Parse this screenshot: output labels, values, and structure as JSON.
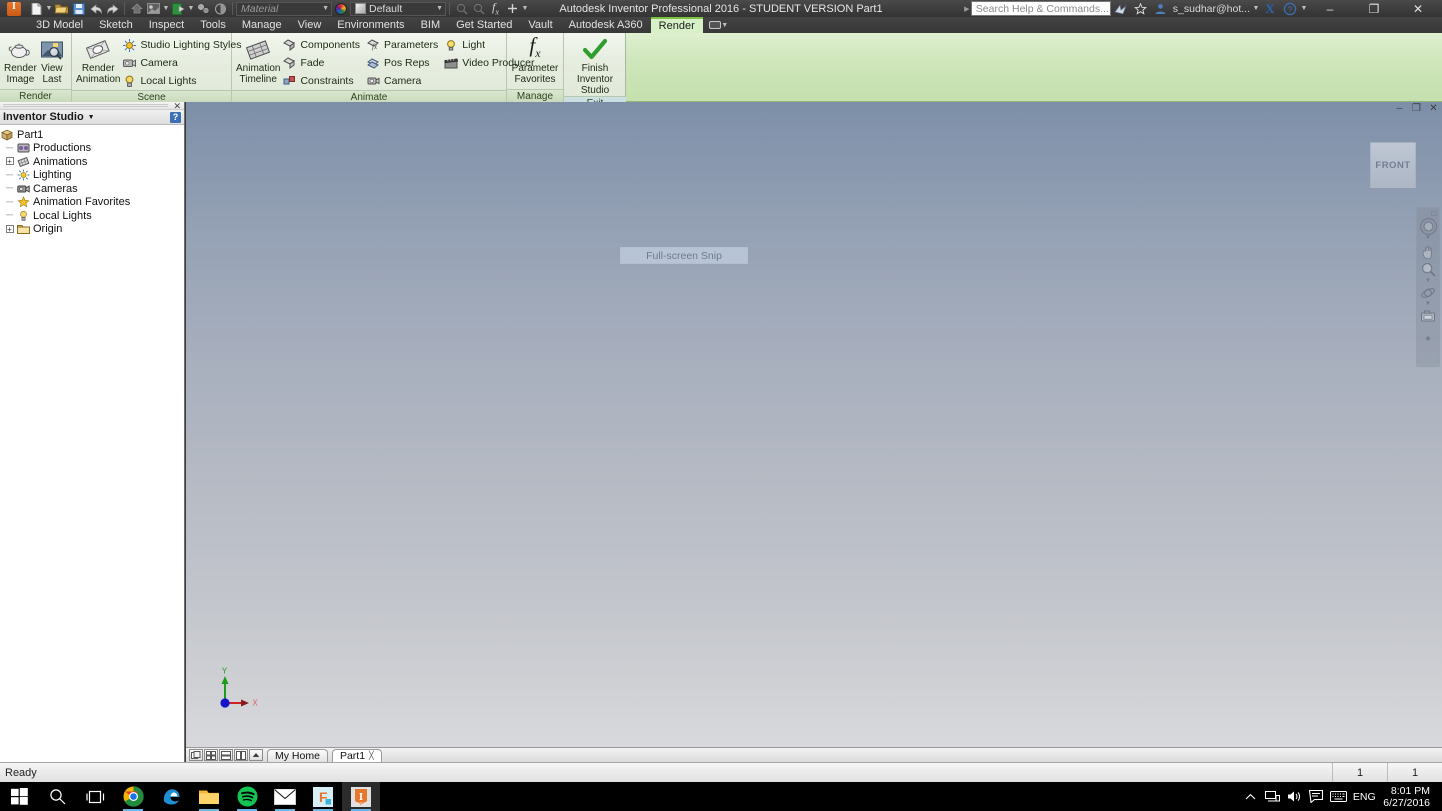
{
  "titlebar": {
    "app_logo": "inventor-logo",
    "title": "Autodesk Inventor Professional 2016 - STUDENT VERSION    Part1",
    "quick_access": [
      {
        "name": "new-file",
        "icon": "new-document-icon",
        "caret": true
      },
      {
        "name": "open-file",
        "icon": "open-folder-icon",
        "caret": false
      },
      {
        "name": "save-file",
        "icon": "save-disk-icon",
        "caret": false
      },
      {
        "name": "undo",
        "icon": "undo-arrow-icon",
        "caret": false
      },
      {
        "name": "redo",
        "icon": "redo-arrow-icon",
        "caret": false
      },
      {
        "name": "home-view",
        "icon": "home-icon",
        "caret": false
      },
      {
        "name": "appearance",
        "icon": "appearance-icon",
        "caret": true
      },
      {
        "name": "visual-style",
        "icon": "visual-style-icon",
        "caret": true
      },
      {
        "name": "component-visibility",
        "icon": "component-icon",
        "caret": false
      },
      {
        "name": "shadows",
        "icon": "shadow-sphere-icon",
        "caret": false
      }
    ],
    "material_combo": {
      "value": "",
      "placeholder": "Material"
    },
    "appearance_combo": {
      "value": "Default"
    },
    "right_icons": [
      {
        "name": "share-icon"
      },
      {
        "name": "favorites-star-icon"
      },
      {
        "name": "user-account-icon"
      }
    ],
    "account": "s_sudhar@hot...",
    "exchange_icon": "autodesk-exchange-icon",
    "help_icon": "help-question-icon",
    "search": {
      "placeholder": "Search Help & Commands..."
    },
    "window_controls": {
      "minimize": "–",
      "maximize": "❐",
      "close": "✕"
    }
  },
  "ribbon_tabs": {
    "items": [
      {
        "label": "3D Model",
        "active": false
      },
      {
        "label": "Sketch",
        "active": false
      },
      {
        "label": "Inspect",
        "active": false
      },
      {
        "label": "Tools",
        "active": false
      },
      {
        "label": "Manage",
        "active": false
      },
      {
        "label": "View",
        "active": false
      },
      {
        "label": "Environments",
        "active": false
      },
      {
        "label": "BIM",
        "active": false
      },
      {
        "label": "Get Started",
        "active": false
      },
      {
        "label": "Vault",
        "active": false
      },
      {
        "label": "Autodesk A360",
        "active": false
      },
      {
        "label": "Render",
        "active": true
      }
    ]
  },
  "ribbon": {
    "panels": [
      {
        "title": "Render",
        "big_buttons": [
          {
            "name": "render-image-button",
            "line1": "Render",
            "line2": "Image",
            "icon": "teapot-icon"
          },
          {
            "name": "view-last-button",
            "line1": "View",
            "line2": "Last",
            "icon": "picture-zoom-icon"
          }
        ]
      },
      {
        "title": "Scene",
        "big_buttons": [
          {
            "name": "render-animation-button",
            "line1": "Render",
            "line2": "Animation",
            "icon": "teapot-film-icon"
          }
        ],
        "small_buttons": [
          {
            "name": "studio-lighting-styles-button",
            "label": "Studio Lighting Styles",
            "icon": "lighting-styles-icon"
          },
          {
            "name": "camera-button",
            "label": "Camera",
            "icon": "camera-icon"
          },
          {
            "name": "local-lights-button",
            "label": "Local Lights",
            "icon": "bulb-icon"
          }
        ]
      },
      {
        "title": "Animate",
        "big_buttons": [
          {
            "name": "animation-timeline-button",
            "line1": "Animation",
            "line2": "Timeline",
            "icon": "timeline-icon"
          }
        ],
        "small_buttons": [
          {
            "name": "animate-components-button",
            "label": "Components",
            "icon": "components-icon"
          },
          {
            "name": "animate-fade-button",
            "label": "Fade",
            "icon": "fade-icon"
          },
          {
            "name": "animate-constraints-button",
            "label": "Constraints",
            "icon": "constraints-icon"
          },
          {
            "name": "animate-parameters-button",
            "label": "Parameters",
            "icon": "parameters-icon"
          },
          {
            "name": "animate-posreps-button",
            "label": "Pos Reps",
            "icon": "posreps-icon"
          },
          {
            "name": "animate-camera-button",
            "label": "Camera",
            "icon": "camera-anim-icon"
          },
          {
            "name": "animate-light-button",
            "label": "Light",
            "icon": "light-bulb-icon"
          },
          {
            "name": "video-producer-button",
            "label": "Video Producer",
            "icon": "clapperboard-icon"
          }
        ]
      },
      {
        "title": "Manage",
        "big_buttons": [
          {
            "name": "parameter-favorites-button",
            "line1": "Parameter",
            "line2": "Favorites",
            "icon": "fx-icon"
          }
        ]
      },
      {
        "title": "Exit",
        "big_buttons": [
          {
            "name": "finish-inventor-studio-button",
            "line1": "Finish",
            "line2": "Inventor Studio",
            "icon": "green-check-icon"
          }
        ]
      }
    ]
  },
  "browser": {
    "header": "Inventor Studio",
    "help_icon": "help-question-icon",
    "close_icon": "close-icon",
    "tree": [
      {
        "label": "Part1",
        "icon": "part-icon",
        "depth": 0,
        "expander": "none"
      },
      {
        "label": "Productions",
        "icon": "productions-icon",
        "depth": 1,
        "expander": "none"
      },
      {
        "label": "Animations",
        "icon": "animations-icon",
        "depth": 1,
        "expander": "plus"
      },
      {
        "label": "Lighting",
        "icon": "lighting-icon",
        "depth": 1,
        "expander": "none"
      },
      {
        "label": "Cameras",
        "icon": "cameras-icon",
        "depth": 1,
        "expander": "none"
      },
      {
        "label": "Animation Favorites",
        "icon": "star-icon",
        "depth": 1,
        "expander": "none"
      },
      {
        "label": "Local Lights",
        "icon": "bulb-icon",
        "depth": 1,
        "expander": "none"
      },
      {
        "label": "Origin",
        "icon": "folder-icon",
        "depth": 1,
        "expander": "plus"
      }
    ]
  },
  "viewport": {
    "tooltip": "Full-screen Snip",
    "viewcube_face": "FRONT",
    "axes": {
      "x_label": "X",
      "y_label": "Y",
      "x_color": "#cc2222",
      "y_color": "#1d9b1d",
      "origin_color": "#1414cc"
    },
    "doc_controls": {
      "minimize": "–",
      "restore": "❐",
      "close": "✕"
    },
    "navbar": [
      {
        "name": "steering-wheel-icon"
      },
      {
        "name": "pan-hand-icon"
      },
      {
        "name": "zoom-magnifier-icon"
      },
      {
        "name": "orbit-icon"
      },
      {
        "name": "look-at-camera-icon"
      }
    ]
  },
  "tabstrip": {
    "view_buttons": [
      {
        "name": "single-view-button",
        "icon": "single-window-icon"
      },
      {
        "name": "tile-view-button",
        "icon": "tile-windows-icon"
      },
      {
        "name": "horizontal-split-button",
        "icon": "horizontal-split-icon"
      },
      {
        "name": "vertical-split-button",
        "icon": "vertical-split-icon"
      },
      {
        "name": "scroll-up-button",
        "icon": "chevron-up-icon"
      }
    ],
    "tabs": [
      {
        "label": "My Home",
        "active": false,
        "closable": false
      },
      {
        "label": "Part1",
        "active": true,
        "closable": true
      }
    ]
  },
  "statusbar": {
    "message": "Ready",
    "cell1": "1",
    "cell2": "1"
  },
  "taskbar": {
    "items": [
      {
        "name": "start-button",
        "icon": "windows-logo-icon",
        "running": false,
        "active": false
      },
      {
        "name": "search-button",
        "icon": "search-icon",
        "running": false,
        "active": false
      },
      {
        "name": "task-view-button",
        "icon": "task-view-icon",
        "running": false,
        "active": false
      },
      {
        "name": "chrome-button",
        "icon": "chrome-icon",
        "running": true,
        "active": false
      },
      {
        "name": "edge-button",
        "icon": "edge-icon",
        "running": false,
        "active": false
      },
      {
        "name": "file-explorer-button",
        "icon": "folder-icon",
        "running": true,
        "active": false
      },
      {
        "name": "spotify-button",
        "icon": "spotify-icon",
        "running": true,
        "active": false
      },
      {
        "name": "mail-button",
        "icon": "mail-icon",
        "running": true,
        "active": false
      },
      {
        "name": "fusion-button",
        "icon": "fusion-icon",
        "running": true,
        "active": false
      },
      {
        "name": "inventor-button",
        "icon": "inventor-icon",
        "running": true,
        "active": true
      }
    ],
    "tray": [
      {
        "name": "show-hidden-icons",
        "icon": "chevron-up-icon"
      },
      {
        "name": "network-icon",
        "icon": "network-icon"
      },
      {
        "name": "volume-icon",
        "icon": "speaker-icon"
      },
      {
        "name": "action-center-icon",
        "icon": "message-icon"
      },
      {
        "name": "keyboard-layout-icon",
        "icon": "keyboard-icon"
      }
    ],
    "language": "ENG",
    "time": "8:01 PM",
    "date": "6/27/2016"
  }
}
